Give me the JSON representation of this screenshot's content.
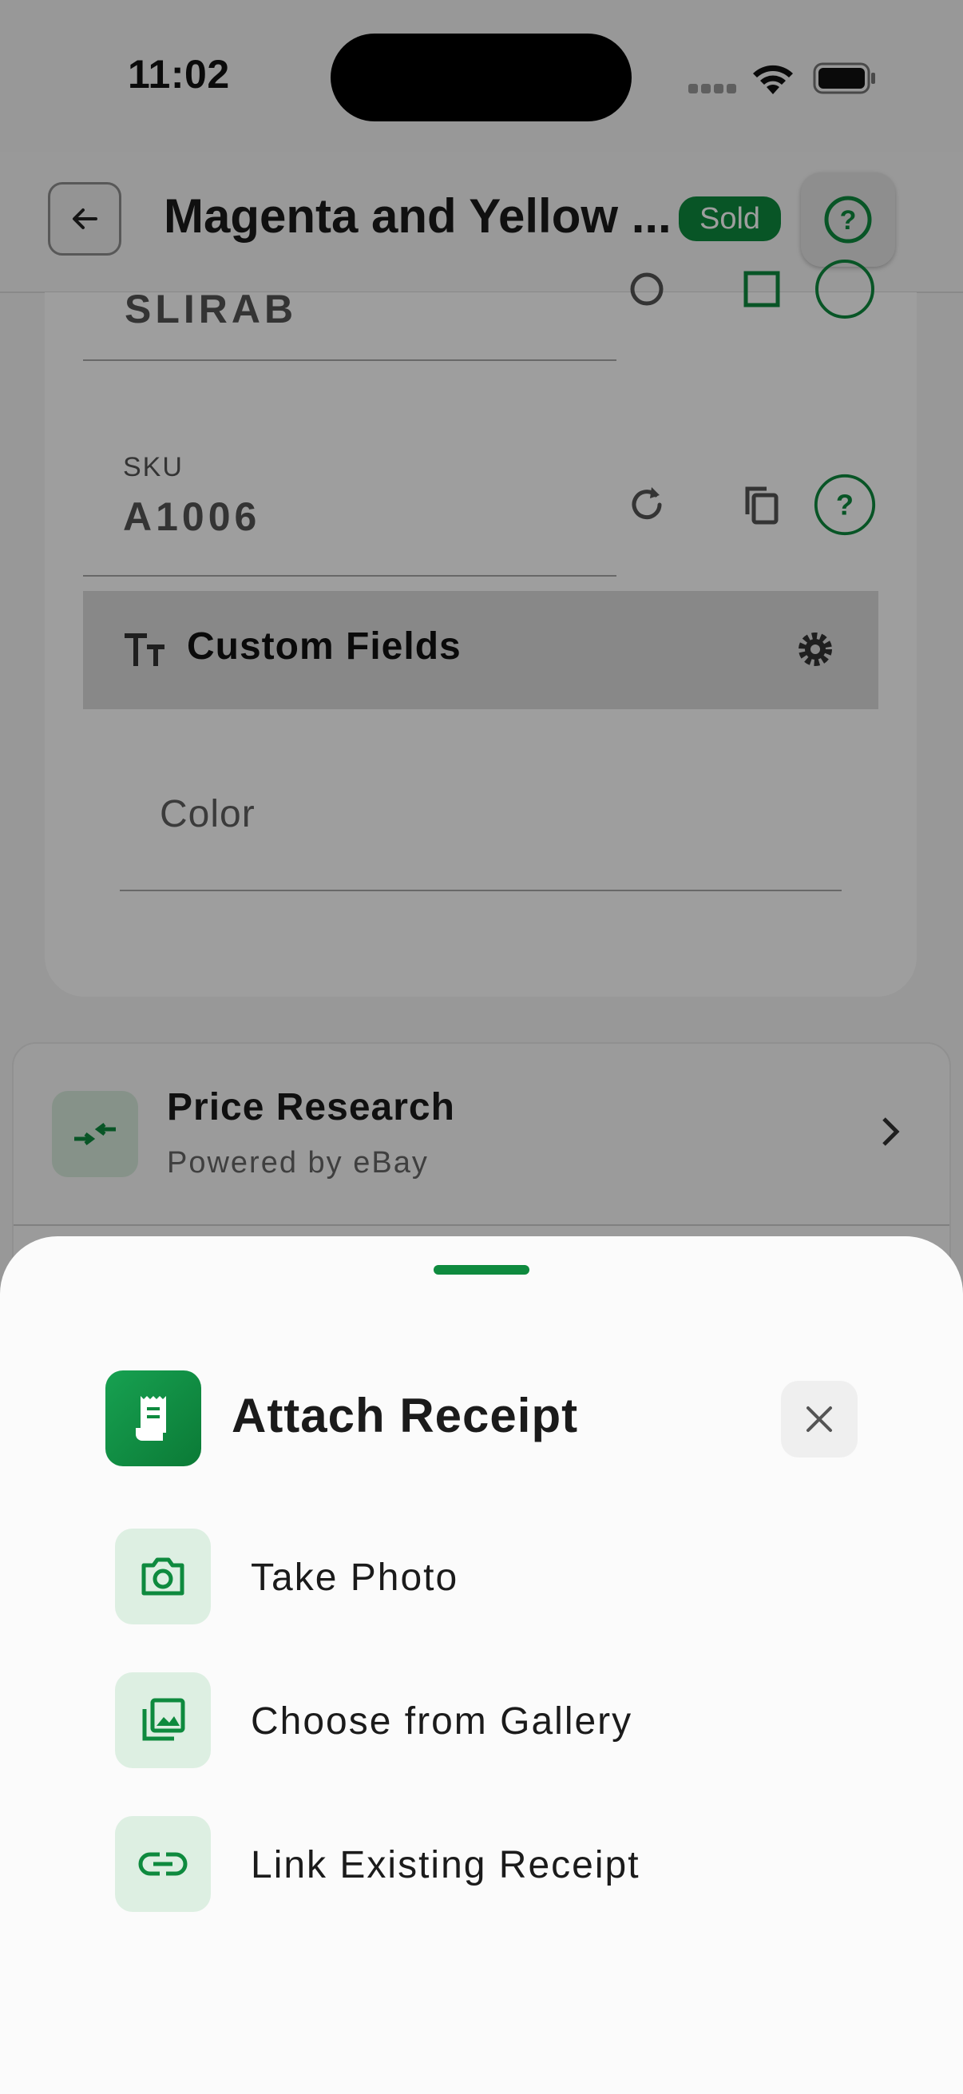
{
  "status_bar": {
    "time": "11:02"
  },
  "header": {
    "title": "Magenta and Yellow ...",
    "badge": "Sold"
  },
  "form": {
    "barcode_value": "SLIRAB",
    "sku_label": "SKU",
    "sku_value": "A1006",
    "custom_fields_title": "Custom Fields",
    "color_placeholder": "Color"
  },
  "price_research": {
    "title": "Price Research",
    "subtitle": "Powered by eBay"
  },
  "sheet": {
    "title": "Attach Receipt",
    "options": [
      {
        "label": "Take Photo",
        "icon": "camera-icon"
      },
      {
        "label": "Choose from Gallery",
        "icon": "gallery-icon"
      },
      {
        "label": "Link Existing Receipt",
        "icon": "link-icon"
      }
    ]
  },
  "colors": {
    "accent": "#0E8A3E",
    "accent_light": "#DDEFE2"
  }
}
